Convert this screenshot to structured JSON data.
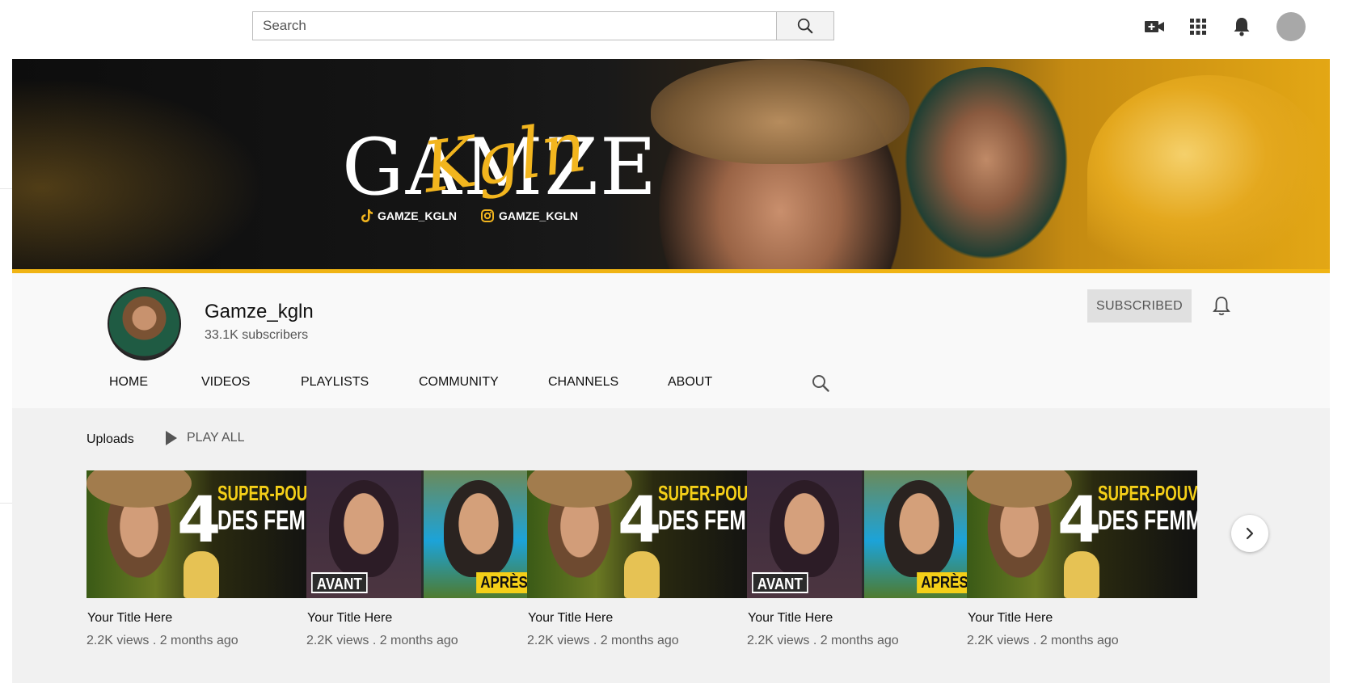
{
  "topbar": {
    "search_placeholder": "Search",
    "icons": [
      "search-icon",
      "create-video-icon",
      "apps-grid-icon",
      "notifications-bell-icon",
      "account-avatar"
    ]
  },
  "banner": {
    "logo_main": "GAMZE",
    "logo_script": "Kgln",
    "socials": [
      {
        "icon": "tiktok-icon",
        "handle": "GAMZE_KGLN"
      },
      {
        "icon": "instagram-icon",
        "handle": "GAMZE_KGLN"
      }
    ],
    "accent_color": "#f0b414"
  },
  "channel": {
    "name": "Gamze_kgln",
    "subscribers": "33.1K subscribers",
    "subscribe_label": "SUBSCRIBED"
  },
  "tabs": [
    {
      "label": "HOME"
    },
    {
      "label": "VIDEOS"
    },
    {
      "label": "PLAYLISTS"
    },
    {
      "label": "COMMUNITY"
    },
    {
      "label": "CHANNELS"
    },
    {
      "label": "ABOUT"
    }
  ],
  "uploads": {
    "label": "Uploads",
    "play_all": "PLAY ALL",
    "videos": [
      {
        "thumb_type": "superpouvoirs",
        "thumb_lines": [
          "4",
          "SUPER-POUVOIRS",
          "DES FEMMES"
        ],
        "title": "Your Title Here",
        "meta": "2.2K views . 2 months ago"
      },
      {
        "thumb_type": "avantapres",
        "thumb_lines": [
          "AVANT",
          "APRÈS"
        ],
        "title": "Your Title Here",
        "meta": "2.2K views . 2 months ago"
      },
      {
        "thumb_type": "superpouvoirs",
        "thumb_lines": [
          "4",
          "SUPER-POUVOIRS",
          "DES FEMMES"
        ],
        "title": "Your Title Here",
        "meta": "2.2K views . 2 months ago"
      },
      {
        "thumb_type": "avantapres",
        "thumb_lines": [
          "AVANT",
          "APRÈS"
        ],
        "title": "Your Title Here",
        "meta": "2.2K views . 2 months ago"
      },
      {
        "thumb_type": "superpouvoirs",
        "thumb_lines": [
          "4",
          "SUPER-POUVOIRS",
          "DES FEMMES"
        ],
        "title": "Your Title Here",
        "meta": "2.2K views . 2 months ago"
      }
    ]
  }
}
